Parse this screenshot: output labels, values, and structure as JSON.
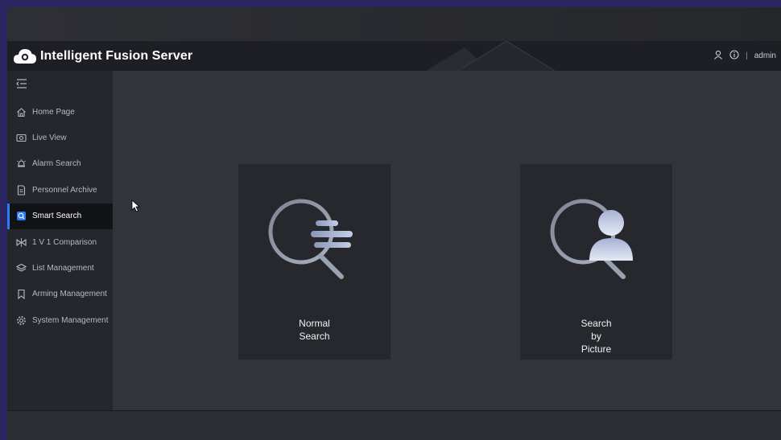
{
  "app": {
    "title": "Intelligent Fusion Server",
    "user": "admin",
    "separator": "|"
  },
  "sidebar": {
    "items": [
      {
        "label": "Home Page",
        "icon": "home-icon"
      },
      {
        "label": "Live View",
        "icon": "camera-icon"
      },
      {
        "label": "Alarm Search",
        "icon": "alarm-icon"
      },
      {
        "label": "Personnel Archive",
        "icon": "document-icon"
      },
      {
        "label": "Smart Search",
        "icon": "smart-search-icon",
        "active": true
      },
      {
        "label": "1 V 1 Comparison",
        "icon": "compare-icon"
      },
      {
        "label": "List Management",
        "icon": "layers-icon"
      },
      {
        "label": "Arming Management",
        "icon": "bookmark-icon"
      },
      {
        "label": "System Management",
        "icon": "gear-icon"
      }
    ]
  },
  "main": {
    "cards": [
      {
        "label": "Normal\nSearch",
        "icon": "normal-search-icon"
      },
      {
        "label": "Search\nby\nPicture",
        "icon": "picture-search-icon"
      }
    ]
  },
  "colors": {
    "accent": "#2d7cf6",
    "header_bg": "#1d1f24",
    "sidebar_bg": "#26272c",
    "main_bg": "#32343b",
    "card_bg": "#27282d"
  }
}
